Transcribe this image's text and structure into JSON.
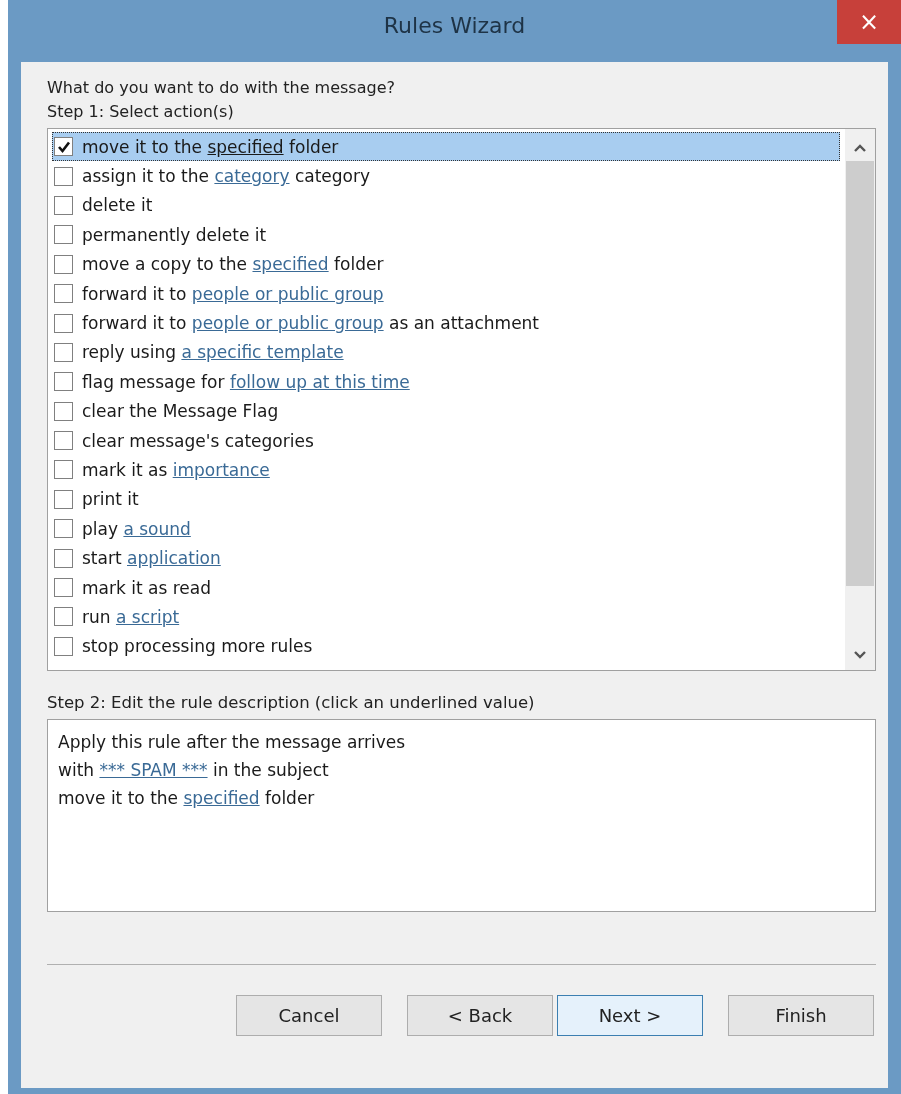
{
  "window": {
    "title": "Rules Wizard",
    "close": "×"
  },
  "question": "What do you want to do with the message?",
  "step1": "Step 1: Select action(s)",
  "actions": [
    {
      "checked": true,
      "selected": true,
      "parts": [
        {
          "text": "move it to the ",
          "link": false
        },
        {
          "text": "specified",
          "link": true
        },
        {
          "text": " folder",
          "link": false
        }
      ]
    },
    {
      "checked": false,
      "selected": false,
      "parts": [
        {
          "text": "assign it to the ",
          "link": false
        },
        {
          "text": "category",
          "link": true
        },
        {
          "text": " category",
          "link": false
        }
      ]
    },
    {
      "checked": false,
      "selected": false,
      "parts": [
        {
          "text": "delete it",
          "link": false
        }
      ]
    },
    {
      "checked": false,
      "selected": false,
      "parts": [
        {
          "text": "permanently delete it",
          "link": false
        }
      ]
    },
    {
      "checked": false,
      "selected": false,
      "parts": [
        {
          "text": "move a copy to the ",
          "link": false
        },
        {
          "text": "specified",
          "link": true
        },
        {
          "text": " folder",
          "link": false
        }
      ]
    },
    {
      "checked": false,
      "selected": false,
      "parts": [
        {
          "text": "forward it to ",
          "link": false
        },
        {
          "text": "people or public group",
          "link": true
        }
      ]
    },
    {
      "checked": false,
      "selected": false,
      "parts": [
        {
          "text": "forward it to ",
          "link": false
        },
        {
          "text": "people or public group",
          "link": true
        },
        {
          "text": " as an attachment",
          "link": false
        }
      ]
    },
    {
      "checked": false,
      "selected": false,
      "parts": [
        {
          "text": "reply using ",
          "link": false
        },
        {
          "text": "a specific template",
          "link": true
        }
      ]
    },
    {
      "checked": false,
      "selected": false,
      "parts": [
        {
          "text": "flag message for ",
          "link": false
        },
        {
          "text": "follow up at this time",
          "link": true
        }
      ]
    },
    {
      "checked": false,
      "selected": false,
      "parts": [
        {
          "text": "clear the Message Flag",
          "link": false
        }
      ]
    },
    {
      "checked": false,
      "selected": false,
      "parts": [
        {
          "text": "clear message's categories",
          "link": false
        }
      ]
    },
    {
      "checked": false,
      "selected": false,
      "parts": [
        {
          "text": "mark it as ",
          "link": false
        },
        {
          "text": "importance",
          "link": true
        }
      ]
    },
    {
      "checked": false,
      "selected": false,
      "parts": [
        {
          "text": "print it",
          "link": false
        }
      ]
    },
    {
      "checked": false,
      "selected": false,
      "parts": [
        {
          "text": "play ",
          "link": false
        },
        {
          "text": "a sound",
          "link": true
        }
      ]
    },
    {
      "checked": false,
      "selected": false,
      "parts": [
        {
          "text": "start ",
          "link": false
        },
        {
          "text": "application",
          "link": true
        }
      ]
    },
    {
      "checked": false,
      "selected": false,
      "parts": [
        {
          "text": "mark it as read",
          "link": false
        }
      ]
    },
    {
      "checked": false,
      "selected": false,
      "parts": [
        {
          "text": "run ",
          "link": false
        },
        {
          "text": "a script",
          "link": true
        }
      ]
    },
    {
      "checked": false,
      "selected": false,
      "parts": [
        {
          "text": "stop processing more rules",
          "link": false
        }
      ]
    }
  ],
  "step2": "Step 2: Edit the rule description (click an underlined value)",
  "description": [
    [
      {
        "text": "Apply this rule after the message arrives",
        "link": false
      }
    ],
    [
      {
        "text": "with ",
        "link": false
      },
      {
        "text": "*** SPAM ***",
        "link": true
      },
      {
        "text": " in the subject",
        "link": false
      }
    ],
    [
      {
        "text": "move it to the ",
        "link": false
      },
      {
        "text": "specified",
        "link": true
      },
      {
        "text": " folder",
        "link": false
      }
    ]
  ],
  "buttons": [
    {
      "label": "Cancel",
      "default": false
    },
    {
      "label": "< Back",
      "default": false
    },
    {
      "label": "Next >",
      "default": true
    },
    {
      "label": "Finish",
      "default": false
    }
  ]
}
